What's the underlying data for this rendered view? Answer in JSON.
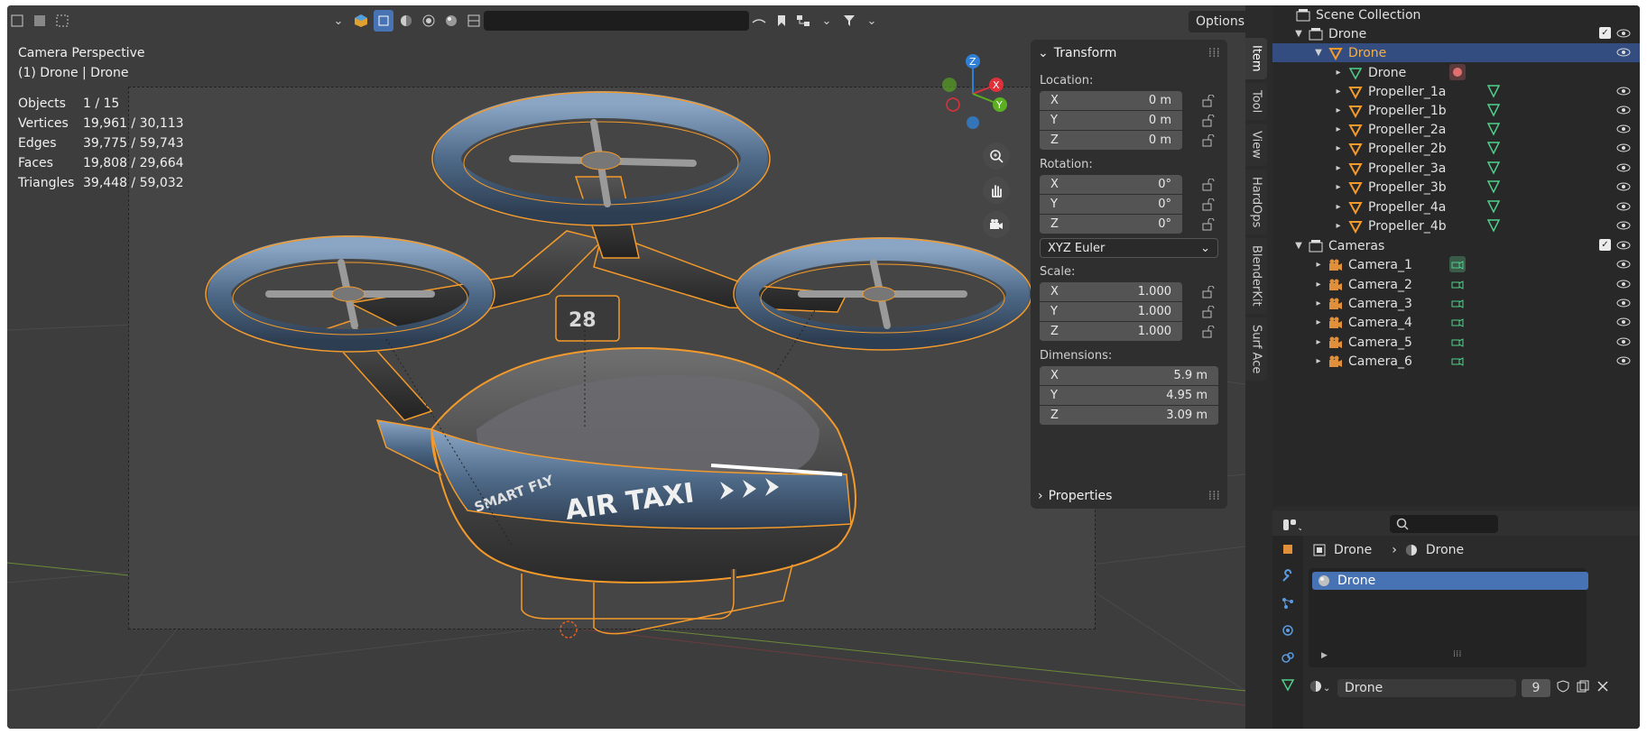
{
  "viewport": {
    "title": "Camera Perspective",
    "subtitle": "(1) Drone | Drone",
    "options_label": "Options",
    "stats": [
      {
        "label": "Objects",
        "value": "1 / 15"
      },
      {
        "label": "Vertices",
        "value": "19,961 / 30,113"
      },
      {
        "label": "Edges",
        "value": "39,775 / 59,743"
      },
      {
        "label": "Faces",
        "value": "19,808 / 29,664"
      },
      {
        "label": "Triangles",
        "value": "39,448 / 59,032"
      }
    ],
    "decal_main": "AIR TAXI",
    "decal_brand": "SMART FLY",
    "decal_number": "28",
    "gizmo": {
      "x": "X",
      "y": "Y",
      "z": "Z"
    }
  },
  "npanel": {
    "transform_label": "Transform",
    "location_label": "Location:",
    "location": [
      {
        "axis": "X",
        "value": "0 m"
      },
      {
        "axis": "Y",
        "value": "0 m"
      },
      {
        "axis": "Z",
        "value": "0 m"
      }
    ],
    "rotation_label": "Rotation:",
    "rotation": [
      {
        "axis": "X",
        "value": "0°"
      },
      {
        "axis": "Y",
        "value": "0°"
      },
      {
        "axis": "Z",
        "value": "0°"
      }
    ],
    "rotation_mode": "XYZ Euler",
    "scale_label": "Scale:",
    "scale": [
      {
        "axis": "X",
        "value": "1.000"
      },
      {
        "axis": "Y",
        "value": "1.000"
      },
      {
        "axis": "Z",
        "value": "1.000"
      }
    ],
    "dimensions_label": "Dimensions:",
    "dimensions": [
      {
        "axis": "X",
        "value": "5.9 m"
      },
      {
        "axis": "Y",
        "value": "4.95 m"
      },
      {
        "axis": "Z",
        "value": "3.09 m"
      }
    ],
    "properties_label": "Properties",
    "tabs": [
      "Item",
      "Tool",
      "View",
      "HardOps",
      "BlenderKit",
      "Surf Ace"
    ]
  },
  "outliner": {
    "scene_collection": "Scene Collection",
    "rows": [
      {
        "label": "Drone"
      },
      {
        "label": "Drone"
      },
      {
        "label": "Drone"
      },
      {
        "label": "Propeller_1a"
      },
      {
        "label": "Propeller_1b"
      },
      {
        "label": "Propeller_2a"
      },
      {
        "label": "Propeller_2b"
      },
      {
        "label": "Propeller_3a"
      },
      {
        "label": "Propeller_3b"
      },
      {
        "label": "Propeller_4a"
      },
      {
        "label": "Propeller_4b"
      },
      {
        "label": "Cameras"
      },
      {
        "label": "Camera_1"
      },
      {
        "label": "Camera_2"
      },
      {
        "label": "Camera_3"
      },
      {
        "label": "Camera_4"
      },
      {
        "label": "Camera_5"
      },
      {
        "label": "Camera_6"
      }
    ]
  },
  "properties": {
    "breadcrumb_object": "Drone",
    "breadcrumb_material": "Drone",
    "material_slot": "Drone",
    "material_name": "Drone",
    "user_count": "9"
  },
  "colors": {
    "selection": "#334d80",
    "accent_blue": "#4772b3",
    "outline_orange": "#f39a2b",
    "mesh_data_green": "#4fd08a"
  }
}
